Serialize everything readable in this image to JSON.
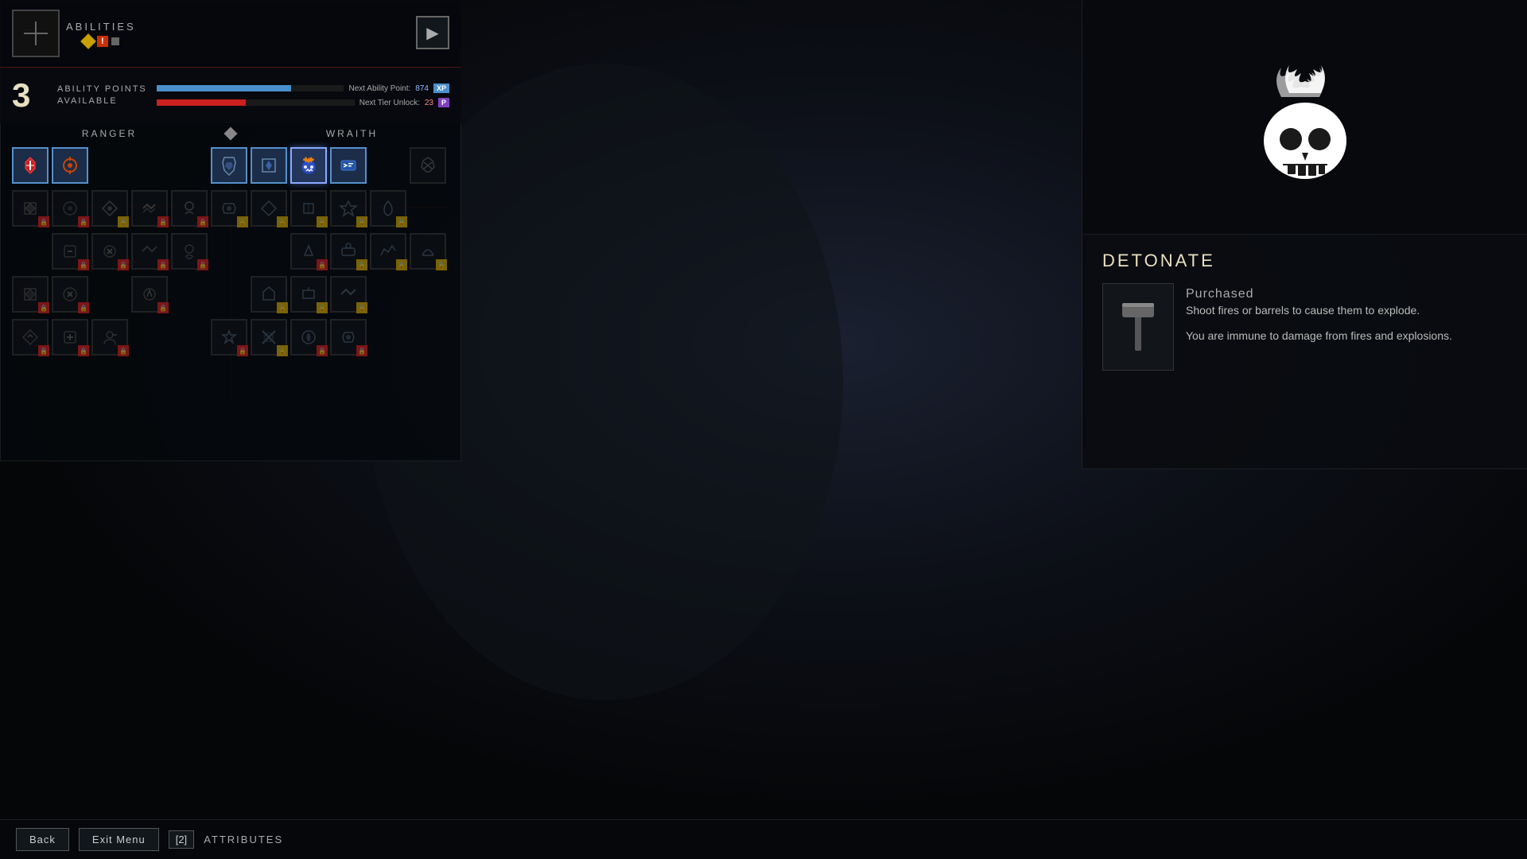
{
  "header": {
    "abilities_label": "ABILITIES",
    "nav_arrow": "▶"
  },
  "ability_points": {
    "count": "3",
    "label_line1": "ABILITY POINTS",
    "label_line2": "AVAILABLE",
    "next_point_label": "Next Ability Point:",
    "next_point_value": "874",
    "next_tier_label": "Next Tier Unlock:",
    "next_tier_value": "23",
    "xp_badge": "XP",
    "tier_badge": "P"
  },
  "sections": {
    "ranger_label": "RANGER",
    "wraith_label": "WRAITH"
  },
  "skill_detail": {
    "name": "DETONATE",
    "status": "Purchased",
    "description_1": "Shoot fires or barrels to cause them to explode.",
    "description_2": "You are immune to damage from fires and explosions."
  },
  "bottom_bar": {
    "back_label": "Back",
    "exit_label": "Exit Menu",
    "key_label": "[2]",
    "attributes_label": "ATTRIBUTES"
  },
  "colors": {
    "accent_blue": "#4a8fcc",
    "accent_red": "#cc2020",
    "accent_gold": "#c8a000",
    "accent_purple": "#8040c0",
    "text_light": "#e8e0c0",
    "text_mid": "#aaaaaa"
  }
}
